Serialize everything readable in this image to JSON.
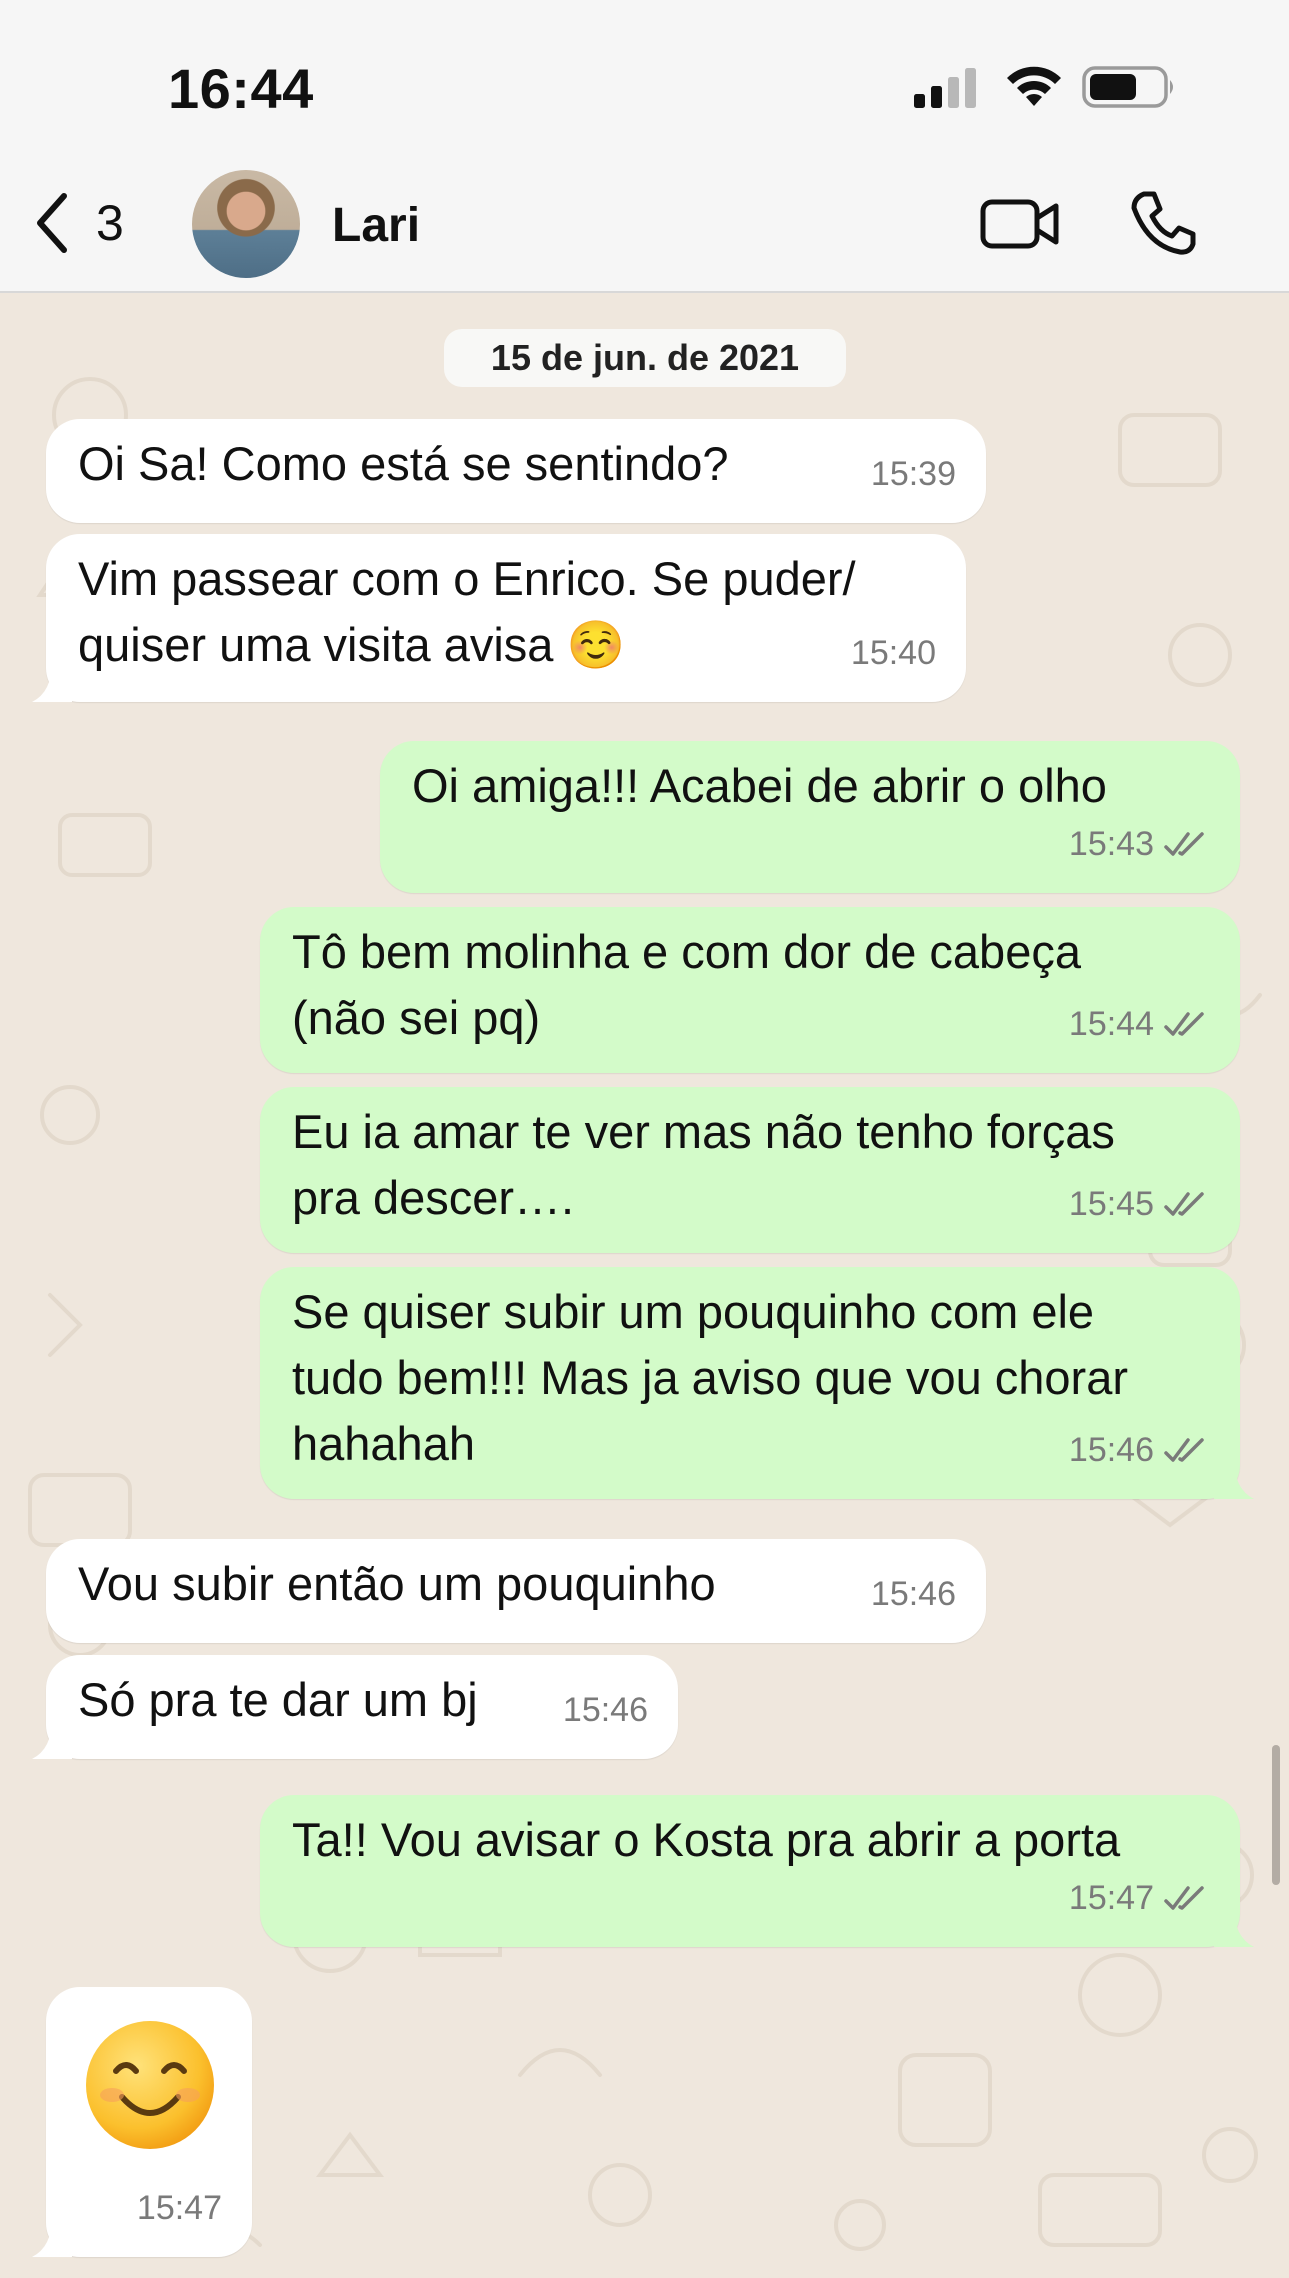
{
  "status_bar": {
    "time": "16:44",
    "icons": [
      "signal-icon",
      "wifi-icon",
      "battery-icon"
    ]
  },
  "header": {
    "back_count": "3",
    "contact_name": "Lari",
    "icons": [
      "back-chevron-icon",
      "video-camera-icon",
      "phone-icon"
    ]
  },
  "chat": {
    "date": "15 de jun. de 2021",
    "messages": [
      {
        "dir": "in",
        "lines": [
          "Oi Sa! Como está se sentindo?"
        ],
        "time": "15:39"
      },
      {
        "dir": "in",
        "lines": [
          "Vim passear com o Enrico. Se puder/",
          "quiser uma visita avisa ☺️"
        ],
        "time": "15:40"
      },
      {
        "dir": "out",
        "lines": [
          "Oi amiga!!! Acabei de abrir o olho"
        ],
        "time": "15:43",
        "status": "read"
      },
      {
        "dir": "out",
        "lines": [
          "Tô bem molinha e com dor de cabeça",
          "(não sei pq)"
        ],
        "time": "15:44",
        "status": "read"
      },
      {
        "dir": "out",
        "lines": [
          "Eu ia amar te ver mas não tenho forças",
          "pra descer…."
        ],
        "time": "15:45",
        "status": "read"
      },
      {
        "dir": "out",
        "lines": [
          "Se quiser subir um pouquinho com ele",
          "tudo bem!!! Mas ja aviso que vou chorar",
          "hahahah"
        ],
        "time": "15:46",
        "status": "read"
      },
      {
        "dir": "in",
        "lines": [
          "Vou subir então um pouquinho"
        ],
        "time": "15:46"
      },
      {
        "dir": "in",
        "lines": [
          "Só pra te dar um bj"
        ],
        "time": "15:46"
      },
      {
        "dir": "out",
        "lines": [
          "Ta!! Vou avisar o Kosta pra abrir a porta"
        ],
        "time": "15:47",
        "status": "read"
      },
      {
        "dir": "in",
        "emoji": "smiling-face-icon",
        "time": "15:47"
      }
    ]
  },
  "colors": {
    "incoming_bubble": "#ffffff",
    "outgoing_bubble": "#d3fbc9",
    "wallpaper": "#efe7dd",
    "read_ticks": "#7a7a7a"
  }
}
